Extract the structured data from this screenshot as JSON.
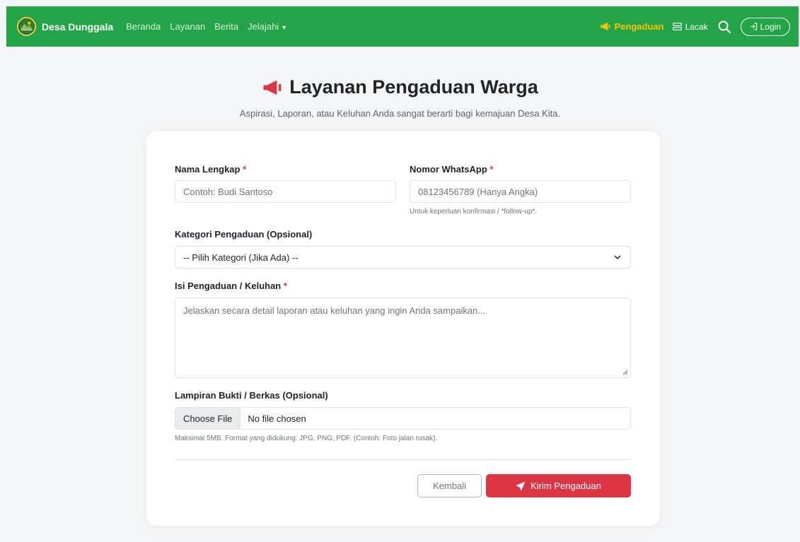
{
  "navbar": {
    "brand": "Desa Dunggala",
    "links": [
      "Beranda",
      "Layanan",
      "Berita"
    ],
    "dropdown_label": "Jelajahi",
    "complaint_label": "Pengaduan",
    "track_label": "Lacak",
    "login_label": "Login",
    "accent_color": "#22a447"
  },
  "header": {
    "title": "Layanan Pengaduan Warga",
    "subtitle": "Aspirasi, Laporan, atau Keluhan Anda sangat berarti bagi kemajuan Desa Kita."
  },
  "form": {
    "name": {
      "label": "Nama Lengkap",
      "required": "*",
      "placeholder": "Contoh: Budi Santoso"
    },
    "phone": {
      "label": "Nomor WhatsApp",
      "required": "*",
      "placeholder": "08123456789 (Hanya Angka)",
      "hint": "Untuk keperluan konfirmasi / *follow-up*."
    },
    "category": {
      "label": "Kategori Pengaduan (Opsional)",
      "selected": "-- Pilih Kategori (Jika Ada) --"
    },
    "content": {
      "label": "Isi Pengaduan / Keluhan",
      "required": "*",
      "placeholder": "Jelaskan secara detail laporan atau keluhan yang ingin Anda sampaikan..."
    },
    "attachment": {
      "label": "Lampiran Bukti / Berkas (Opsional)",
      "button": "Choose File",
      "status": "No file chosen",
      "hint": "Maksimal 5MB. Format yang didukung: JPG, PNG, PDF. (Contoh: Foto jalan rusak)."
    },
    "back_label": "Kembali",
    "submit_label": "Kirim Pengaduan",
    "submit_color": "#dc3545"
  }
}
